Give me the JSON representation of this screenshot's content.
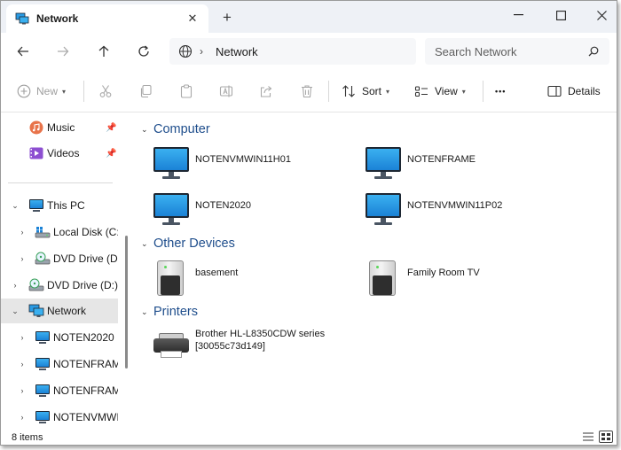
{
  "window": {
    "tab_title": "Network",
    "tab_close_glyph": "✕",
    "new_tab_glyph": "+",
    "minimize_glyph": "—",
    "maximize_glyph": "☐",
    "close_glyph": "✕"
  },
  "address": {
    "location": "Network",
    "search_placeholder": "Search Network"
  },
  "toolbar": {
    "new_label": "New",
    "sort_label": "Sort",
    "view_label": "View",
    "more_label": "•••",
    "details_label": "Details"
  },
  "sidebar": {
    "items": [
      {
        "label": "Music",
        "icon": "music-icon",
        "pinned": true
      },
      {
        "label": "Videos",
        "icon": "videos-icon",
        "pinned": true
      },
      {
        "label": "This PC",
        "icon": "this-pc-icon",
        "expanded": true
      },
      {
        "label": "Local Disk (C:)",
        "icon": "local-disk-icon"
      },
      {
        "label": "DVD Drive (D:)",
        "icon": "dvd-drive-icon"
      },
      {
        "label": "DVD Drive (D:) C",
        "icon": "dvd-drive-icon"
      },
      {
        "label": "Network",
        "icon": "network-icon",
        "expanded": true,
        "selected": true
      },
      {
        "label": "NOTEN2020",
        "icon": "monitor-icon"
      },
      {
        "label": "NOTENFRAME",
        "icon": "monitor-icon"
      },
      {
        "label": "NOTENFRAME",
        "icon": "monitor-icon"
      },
      {
        "label": "NOTENVMWIN",
        "icon": "monitor-icon"
      }
    ]
  },
  "content": {
    "groups": [
      {
        "title": "Computer",
        "items": [
          "NOTENVMWIN11H01",
          "NOTENFRAME",
          "NOTEN2020",
          "NOTENVMWIN11P02"
        ]
      },
      {
        "title": "Other Devices",
        "items": [
          "basement",
          "Family Room TV"
        ]
      },
      {
        "title": "Printers",
        "items": [
          {
            "line1": "Brother HL-L8350CDW series",
            "line2": "[30055c73d149]"
          }
        ]
      }
    ]
  },
  "status": {
    "item_count": "8 items"
  },
  "colors": {
    "accent": "#1f4e8c",
    "selected_bg": "#e6e6e6",
    "titlebar_bg": "#eef1f6"
  }
}
